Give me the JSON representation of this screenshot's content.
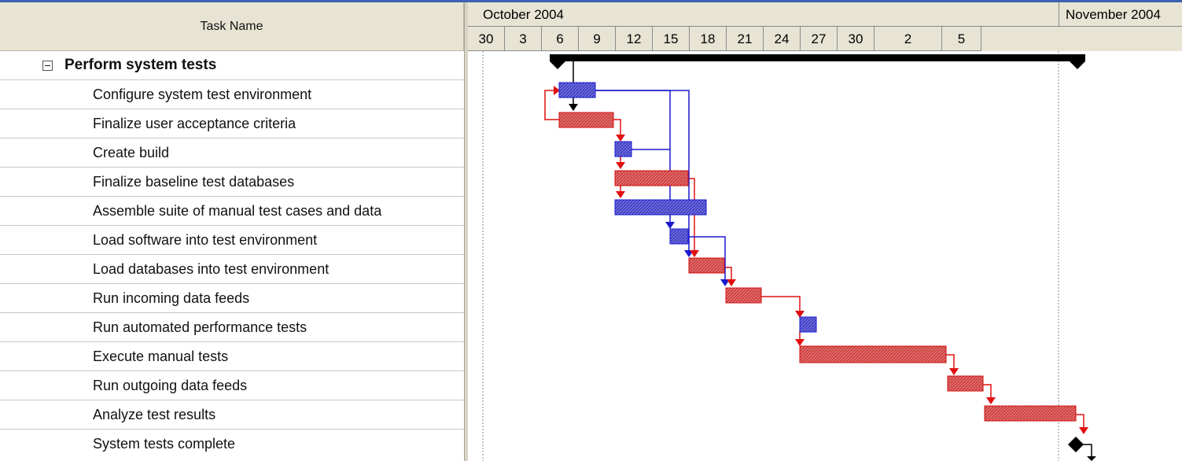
{
  "table": {
    "header": "Task Name"
  },
  "timescale": {
    "months": [
      "October 2004",
      "November 2004"
    ],
    "days": [
      "30",
      "3",
      "6",
      "9",
      "12",
      "15",
      "18",
      "21",
      "24",
      "27",
      "30",
      "2",
      "5"
    ]
  },
  "tasks": [
    {
      "name": "Perform system tests",
      "type": "summary"
    },
    {
      "name": "Configure system test environment",
      "type": "task",
      "critical": false
    },
    {
      "name": "Finalize user acceptance criteria",
      "type": "task",
      "critical": true
    },
    {
      "name": "Create build",
      "type": "task",
      "critical": false
    },
    {
      "name": "Finalize baseline test databases",
      "type": "task",
      "critical": true
    },
    {
      "name": "Assemble suite of manual test cases and data",
      "type": "task",
      "critical": false
    },
    {
      "name": "Load software into test environment",
      "type": "task",
      "critical": false
    },
    {
      "name": "Load databases into test environment",
      "type": "task",
      "critical": true
    },
    {
      "name": "Run incoming data feeds",
      "type": "task",
      "critical": true
    },
    {
      "name": "Run automated performance tests",
      "type": "task",
      "critical": false
    },
    {
      "name": "Execute manual tests",
      "type": "task",
      "critical": true
    },
    {
      "name": "Run outgoing data feeds",
      "type": "task",
      "critical": true
    },
    {
      "name": "Analyze test results",
      "type": "task",
      "critical": true
    },
    {
      "name": "System tests complete",
      "type": "milestone"
    }
  ],
  "colors": {
    "critical_bar": "#e05a5a",
    "critical_link": "#e01010",
    "noncritical_bar": "#5a5ad8",
    "noncritical_link": "#1a1ad0",
    "summary_bar": "#000000"
  }
}
